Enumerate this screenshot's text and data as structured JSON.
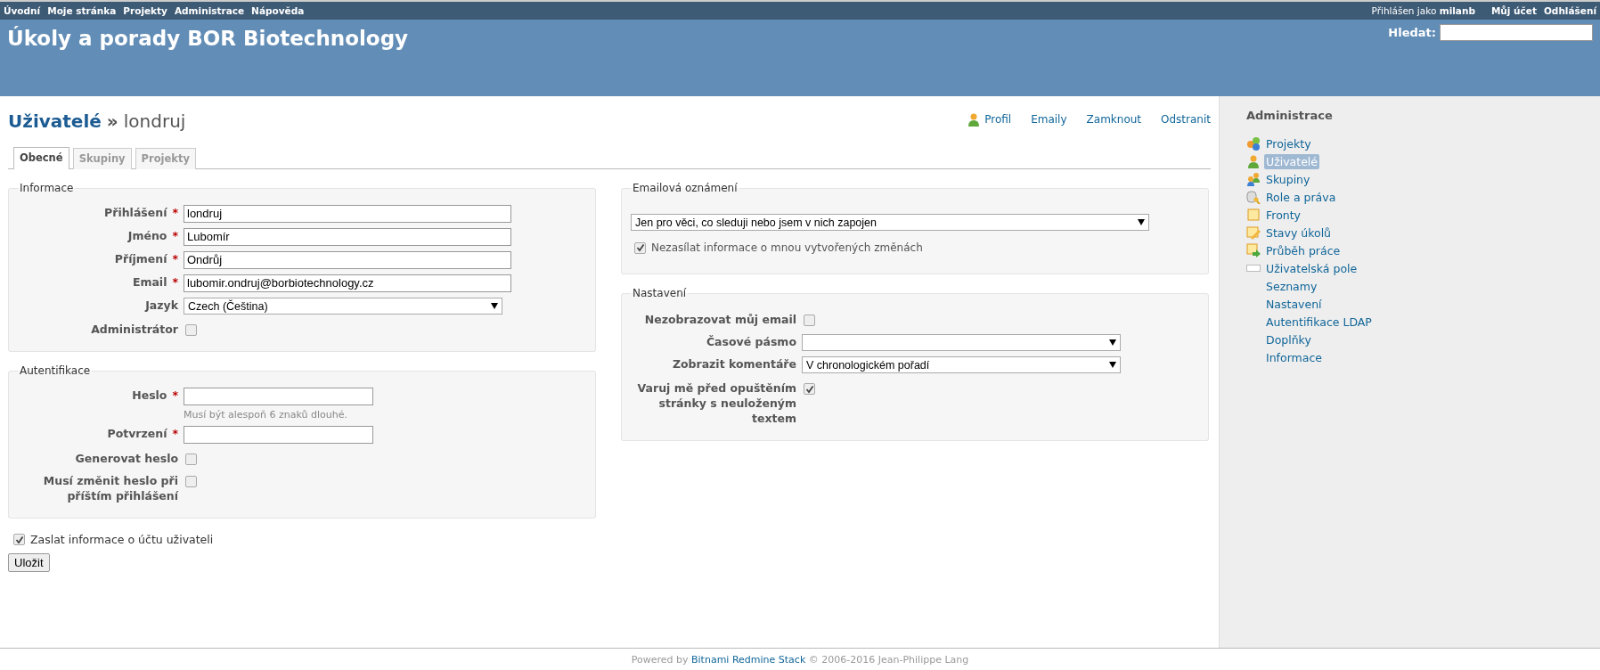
{
  "top_menu": {
    "items": [
      "Úvodní",
      "Moje stránka",
      "Projekty",
      "Administrace",
      "Nápověda"
    ],
    "logged_in": "Přihlášen jako **milanb**",
    "account_links": [
      "Můj účet",
      "Odhlášení"
    ]
  },
  "header": {
    "title": "Úkoly a porady BOR Biotechnology",
    "search": {
      "label": "Hledat:"
    }
  },
  "breadcrumb": {
    "parent": "Uživatelé",
    "separator": "»",
    "current": "londruj"
  },
  "contextual": [
    {
      "label": "Profil",
      "kind": "user"
    },
    {
      "label": "Emaily",
      "kind": "plain"
    },
    {
      "label": "Zamknout",
      "kind": "plain"
    },
    {
      "label": "Odstranit",
      "kind": "plain"
    }
  ],
  "tabs": [
    {
      "label": "Obecné",
      "selected": true
    },
    {
      "label": "Skupiny",
      "selected": false
    },
    {
      "label": "Projekty",
      "selected": false
    }
  ],
  "informace": {
    "legend": "Informace",
    "fields": [
      {
        "kind": "text",
        "label": "Přihlášení",
        "mark": "*",
        "value": "londruj"
      },
      {
        "kind": "text",
        "label": "Jméno",
        "mark": "*",
        "value": "Lubomír"
      },
      {
        "kind": "text",
        "label": "Příjmení",
        "mark": "*",
        "value": "Ondrůj"
      },
      {
        "kind": "text",
        "label": "Email",
        "mark": "*",
        "value": "lubomir.ondruj@borbiotechnology.cz"
      },
      {
        "kind": "select",
        "label": "Jazyk",
        "value": "Czech (Čeština)"
      },
      {
        "kind": "checkbox",
        "label": "Administrátor",
        "checked": false
      }
    ]
  },
  "autentifikace": {
    "legend": "Autentifikace",
    "fields": [
      {
        "kind": "short",
        "label": "Heslo",
        "mark": "*",
        "hint": "Musí být alespoň 6 znaků dlouhé."
      },
      {
        "kind": "short",
        "label": "Potvrzení",
        "mark": "*"
      },
      {
        "kind": "checkbox",
        "label": "Generovat heslo",
        "checked": false
      },
      {
        "kind": "checkbox",
        "label": "Musí změnit heslo při příštím přihlášení",
        "checked": false
      }
    ]
  },
  "send_information": {
    "label": "Zaslat informace o účtu uživateli",
    "checked": true
  },
  "save_button": "Uložit",
  "email_notifications": {
    "legend": "Emailová oznámení",
    "value": "Jen pro věci, co sleduji nebo jsem v nich zapojen",
    "no_self_notified": {
      "label": "Nezasílat informace o mnou vytvořených změnách",
      "checked": true
    }
  },
  "preferences": {
    "legend": "Nastavení",
    "fields": [
      {
        "kind": "checkbox",
        "label": "Nezobrazovat můj email",
        "checked": false
      },
      {
        "kind": "select",
        "label": "Časové pásmo"
      },
      {
        "kind": "select",
        "label": "Zobrazit komentáře",
        "value": "V chronologickém pořadí"
      },
      {
        "kind": "checkbox",
        "label": "Varuj mě před opuštěním stránky s neuloženým textem",
        "checked": true
      }
    ]
  },
  "sidebar": {
    "title": "Administrace",
    "items": [
      {
        "label": "Projekty",
        "kind": "projects",
        "selected": false
      },
      {
        "label": "Uživatelé",
        "kind": "users",
        "selected": true
      },
      {
        "label": "Skupiny",
        "kind": "groups",
        "selected": false
      },
      {
        "label": "Role a práva",
        "kind": "roles",
        "selected": false
      },
      {
        "label": "Fronty",
        "kind": "trackers",
        "selected": false
      },
      {
        "label": "Stavy úkolů",
        "kind": "statuses",
        "selected": false
      },
      {
        "label": "Průběh práce",
        "kind": "workflow",
        "selected": false
      },
      {
        "label": "Uživatelská pole",
        "kind": "custom_fields",
        "selected": false
      },
      {
        "label": "Seznamy",
        "kind": "plain",
        "selected": false
      },
      {
        "label": "Nastavení",
        "kind": "plain",
        "selected": false
      },
      {
        "label": "Autentifikace LDAP",
        "kind": "plain",
        "selected": false
      },
      {
        "label": "Doplňky",
        "kind": "plain",
        "selected": false
      },
      {
        "label": "Informace",
        "kind": "plain",
        "selected": false
      }
    ]
  },
  "footer": {
    "prefix": "Powered by",
    "link": "Bitnami Redmine Stack",
    "suffix": "© 2006-2016 Jean-Philippe Lang"
  }
}
